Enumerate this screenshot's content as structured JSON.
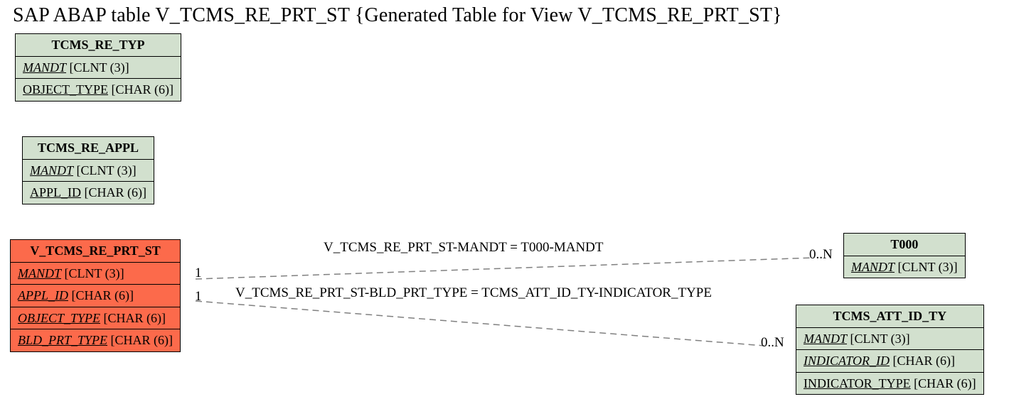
{
  "title": "SAP ABAP table V_TCMS_RE_PRT_ST {Generated Table for View V_TCMS_RE_PRT_ST}",
  "entities": {
    "tcms_re_typ": {
      "name": "TCMS_RE_TYP",
      "fields": [
        {
          "name": "MANDT",
          "type": "[CLNT (3)]",
          "italic": true
        },
        {
          "name": "OBJECT_TYPE",
          "type": "[CHAR (6)]",
          "italic": false
        }
      ]
    },
    "tcms_re_appl": {
      "name": "TCMS_RE_APPL",
      "fields": [
        {
          "name": "MANDT",
          "type": "[CLNT (3)]",
          "italic": true
        },
        {
          "name": "APPL_ID",
          "type": "[CHAR (6)]",
          "italic": false
        }
      ]
    },
    "v_tcms_re_prt_st": {
      "name": "V_TCMS_RE_PRT_ST",
      "fields": [
        {
          "name": "MANDT",
          "type": "[CLNT (3)]",
          "italic": true
        },
        {
          "name": "APPL_ID",
          "type": "[CHAR (6)]",
          "italic": true
        },
        {
          "name": "OBJECT_TYPE",
          "type": "[CHAR (6)]",
          "italic": true
        },
        {
          "name": "BLD_PRT_TYPE",
          "type": "[CHAR (6)]",
          "italic": true
        }
      ]
    },
    "t000": {
      "name": "T000",
      "fields": [
        {
          "name": "MANDT",
          "type": "[CLNT (3)]",
          "italic": true
        }
      ]
    },
    "tcms_att_id_ty": {
      "name": "TCMS_ATT_ID_TY",
      "fields": [
        {
          "name": "MANDT",
          "type": "[CLNT (3)]",
          "italic": true
        },
        {
          "name": "INDICATOR_ID",
          "type": "[CHAR (6)]",
          "italic": true
        },
        {
          "name": "INDICATOR_TYPE",
          "type": "[CHAR (6)]",
          "italic": false
        }
      ]
    }
  },
  "relations": {
    "rel1_label": "V_TCMS_RE_PRT_ST-MANDT = T000-MANDT",
    "rel2_label": "V_TCMS_RE_PRT_ST-BLD_PRT_TYPE = TCMS_ATT_ID_TY-INDICATOR_TYPE",
    "card_1a": "1",
    "card_1b": "1",
    "card_0n_a": "0..N",
    "card_0n_b": "0..N"
  }
}
